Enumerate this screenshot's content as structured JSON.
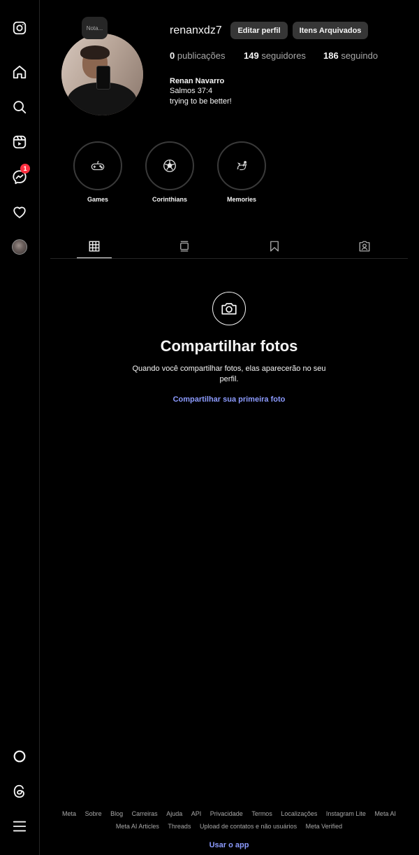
{
  "profile": {
    "username": "renanxdz7",
    "note_label": "Nota...",
    "edit_label": "Editar perfil",
    "archived_label": "Itens Arquivados",
    "stats": {
      "posts_count": "0",
      "posts_label": "publicações",
      "followers_count": "149",
      "followers_label": "seguidores",
      "following_count": "186",
      "following_label": "seguindo"
    },
    "full_name": "Renan Navarro",
    "bio_line1": "Salmos 37:4",
    "bio_line2": "trying to be better!"
  },
  "sidebar": {
    "notifications_badge": "1",
    "icons": [
      "instagram-icon",
      "home-icon",
      "search-icon",
      "reels-icon",
      "messenger-icon",
      "heart-icon",
      "profile-avatar",
      "meta-circle-icon",
      "threads-icon",
      "menu-icon"
    ]
  },
  "highlights": [
    {
      "label": "Games",
      "icon": "gamepad-icon"
    },
    {
      "label": "Corinthians",
      "icon": "soccer-ball-icon"
    },
    {
      "label": "Memories",
      "icon": "dragon-icon"
    }
  ],
  "tabs": [
    {
      "name": "posts",
      "icon": "grid-icon",
      "active": true
    },
    {
      "name": "reels",
      "icon": "reels-tab-icon",
      "active": false
    },
    {
      "name": "saved",
      "icon": "bookmark-icon",
      "active": false
    },
    {
      "name": "tagged",
      "icon": "tagged-icon",
      "active": false
    }
  ],
  "empty_state": {
    "title": "Compartilhar fotos",
    "description": "Quando você compartilhar fotos, elas aparecerão no seu perfil.",
    "link": "Compartilhar sua primeira foto"
  },
  "footer": {
    "row1": [
      "Meta",
      "Sobre",
      "Blog",
      "Carreiras",
      "Ajuda",
      "API",
      "Privacidade",
      "Termos",
      "Localizações",
      "Instagram Lite",
      "Meta AI"
    ],
    "row2": [
      "Meta AI Articles",
      "Threads",
      "Upload de contatos e não usuários",
      "Meta Verified"
    ],
    "cta": "Usar o app"
  },
  "colors": {
    "background": "#000000",
    "text": "#f5f5f5",
    "muted": "#a8a8a8",
    "button": "#363636",
    "link": "#8c9bff",
    "badge": "#ff3040"
  }
}
